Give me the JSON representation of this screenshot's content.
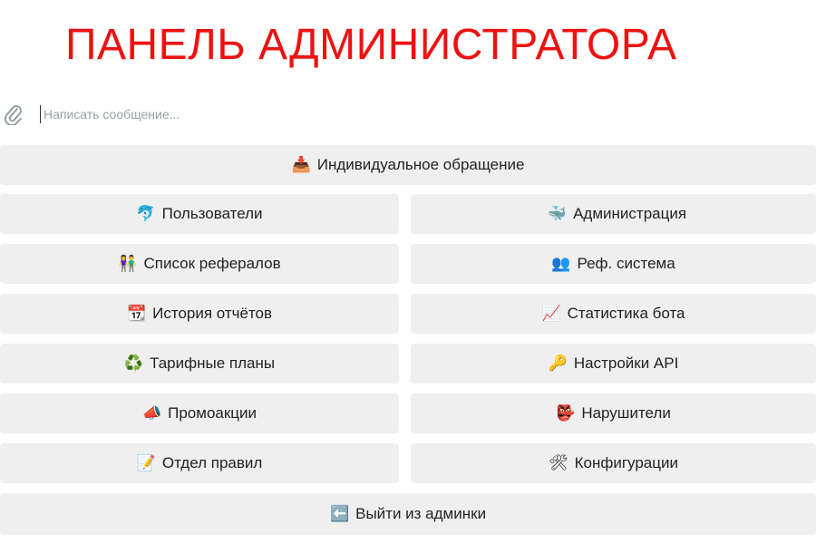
{
  "header": {
    "title": "ПАНЕЛЬ АДМИНИСТРАТОРА"
  },
  "composer": {
    "placeholder": "Написать сообщение..."
  },
  "keyboard": {
    "individual": {
      "icon": "📥",
      "label": "Индивидуальное обращение"
    },
    "users": {
      "icon": "🐬",
      "label": "Пользователи"
    },
    "administration": {
      "icon": "🐳",
      "label": "Администрация"
    },
    "referrals": {
      "icon": "👫",
      "label": "Список рефералов"
    },
    "ref_system": {
      "icon": "👥",
      "label": "Реф. система"
    },
    "reports": {
      "icon": "📆",
      "label": "История отчётов"
    },
    "stats": {
      "icon": "📈",
      "label": "Статистика бота"
    },
    "tariffs": {
      "icon": "♻️",
      "label": "Тарифные планы"
    },
    "api": {
      "icon": "🔑",
      "label": "Настройки API"
    },
    "promo": {
      "icon": "📣",
      "label": "Промоакции"
    },
    "violators": {
      "icon": "👺",
      "label": "Нарушители"
    },
    "rules": {
      "icon": "📝",
      "label": "Отдел правил"
    },
    "config": {
      "icon": "🛠",
      "label": "Конфигурации"
    },
    "exit": {
      "icon": "⬅️",
      "label": "Выйти из админки"
    }
  }
}
